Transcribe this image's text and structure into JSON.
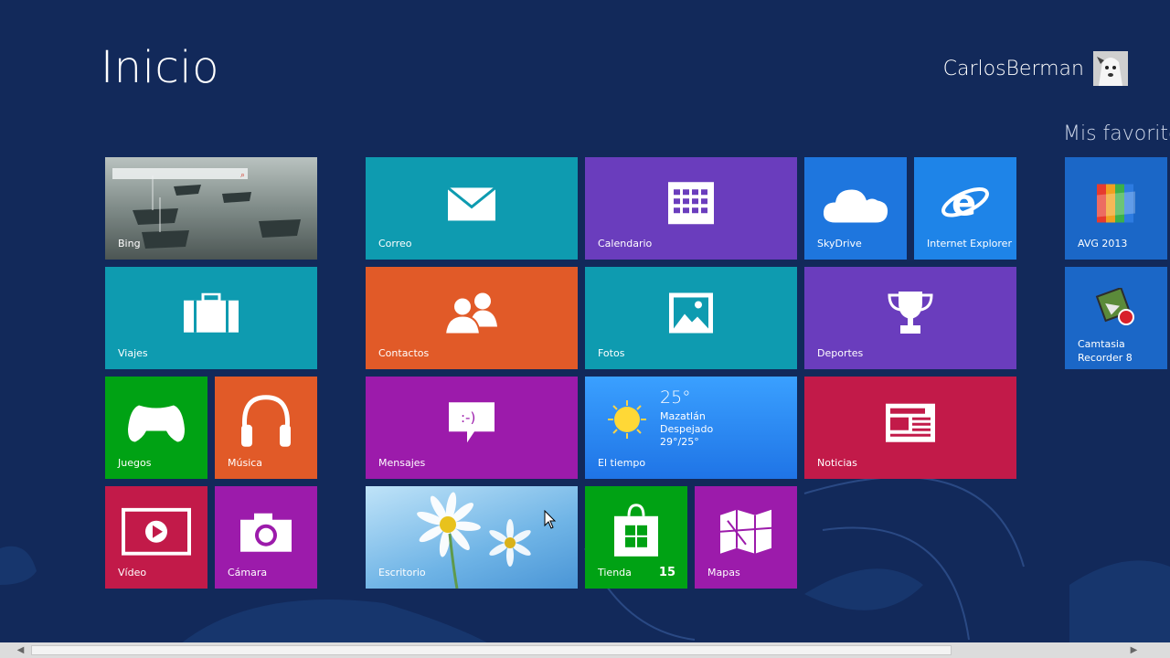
{
  "page": {
    "title": "Inicio"
  },
  "user": {
    "name": "CarlosBerman"
  },
  "groups": {
    "favoritos": "Mis favorito"
  },
  "tiles": {
    "bing": "Bing",
    "correo": "Correo",
    "calendario": "Calendario",
    "skydrive": "SkyDrive",
    "ie": "Internet Explorer",
    "avg": "AVG 2013",
    "viajes": "Viajes",
    "contactos": "Contactos",
    "fotos": "Fotos",
    "deportes": "Deportes",
    "camtasia_line1": "Camtasia",
    "camtasia_line2": "Recorder 8",
    "juegos": "Juegos",
    "musica": "Música",
    "mensajes": "Mensajes",
    "tiempo": "El tiempo",
    "noticias": "Noticias",
    "video": "Vídeo",
    "camara": "Cámara",
    "escritorio": "Escritorio",
    "tienda": "Tienda",
    "tienda_badge": "15",
    "mapas": "Mapas"
  },
  "weather": {
    "temp": "25°",
    "city": "Mazatlán",
    "condition": "Despejado",
    "range": "29°/25°"
  },
  "colors": {
    "background": "#12295a",
    "teal": "#0e9bb0",
    "purple": "#6a3dbd",
    "blue": "#1e76de",
    "orange": "#e15a28",
    "green": "#00a214",
    "magenta": "#9c1bab",
    "crimson": "#c21a49",
    "weather_blue": "#2f8bf3"
  }
}
